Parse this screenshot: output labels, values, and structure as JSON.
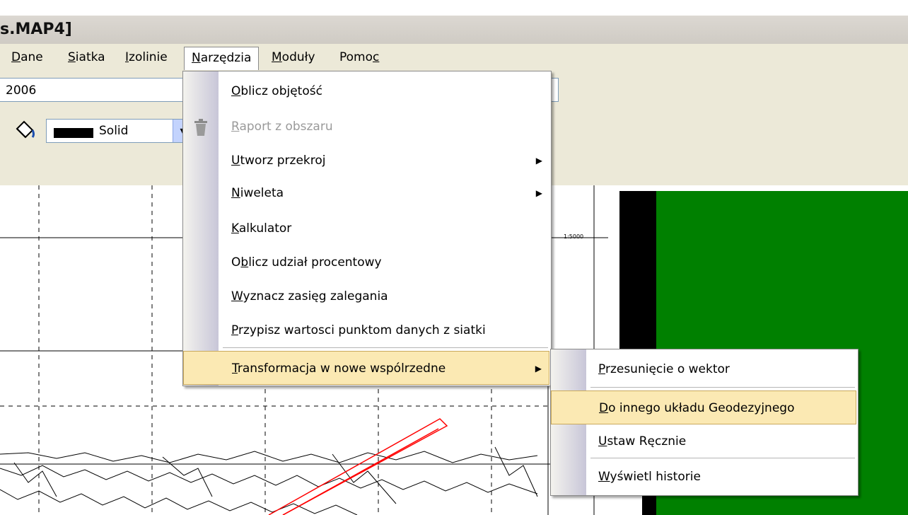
{
  "window": {
    "title": "s.MAP4]"
  },
  "menubar": {
    "items": [
      {
        "id": "dane",
        "label": "Dane"
      },
      {
        "id": "siatka",
        "label": "Siatka"
      },
      {
        "id": "izolinie",
        "label": "Izolinie"
      },
      {
        "id": "narzedzia",
        "label": "Narzędzia"
      },
      {
        "id": "moduly",
        "label": "Moduły"
      },
      {
        "id": "pomoc",
        "label": "Pomoc"
      }
    ]
  },
  "toolbar": {
    "file_value": "2006",
    "fill_icon": "paint-bucket-icon",
    "line_style": "Solid",
    "dropdown_arrow": "▾"
  },
  "map": {
    "scale_label": "1:5000"
  },
  "narzedzia_menu": {
    "items": [
      {
        "label": "Oblicz objętość",
        "disabled": false
      },
      {
        "label": "Raport z obszaru",
        "disabled": true,
        "icon": "trash-icon"
      },
      {
        "label": "Utworz przekroj",
        "submenu": true
      },
      {
        "label": "Niweleta",
        "submenu": true
      },
      {
        "label": "Kalkulator"
      },
      {
        "label": "Oblicz udział procentowy"
      },
      {
        "label": "Wyznacz zasięg zalegania"
      },
      {
        "label": "Przypisz wartosci punktom danych z siatki"
      },
      {
        "label": "Transformacja w nowe wspólrzedne",
        "submenu": true,
        "highlighted": true
      }
    ]
  },
  "transform_submenu": {
    "items": [
      {
        "label": "Przesunięcie o wektor"
      },
      {
        "label": "Do innego układu Geodezyjnego",
        "highlighted": true
      },
      {
        "label": "Ustaw Ręcznie"
      },
      {
        "label": "Wyświetl historie"
      }
    ]
  },
  "colors": {
    "highlight": "#fbe9b3",
    "map_green": "#008000",
    "route": "#ff0000"
  }
}
